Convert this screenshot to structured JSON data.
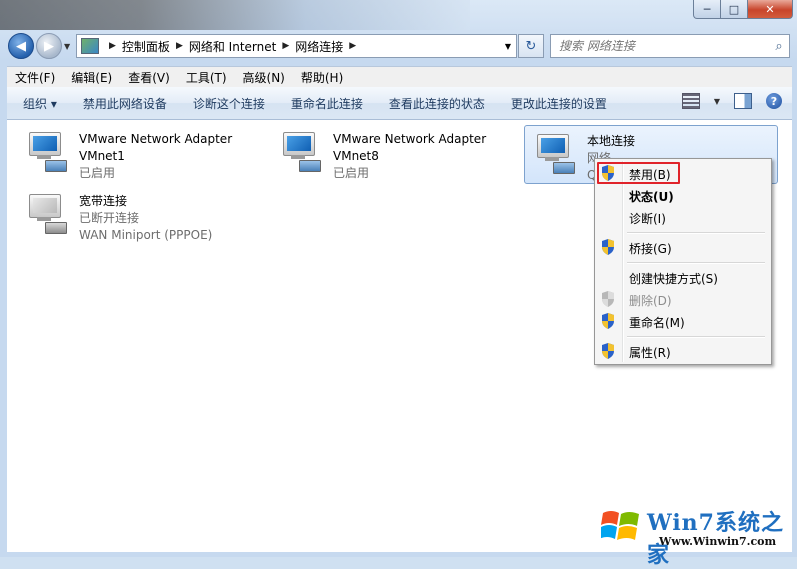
{
  "window": {
    "caption_min": "─",
    "caption_max": "□",
    "caption_close": "✕"
  },
  "nav": {
    "back_glyph": "◀",
    "forward_glyph": "▶",
    "recent_glyph": "▼",
    "breadcrumbs": [
      "控制面板",
      "网络和 Internet",
      "网络连接"
    ],
    "crumb_sep": "▶",
    "addr_drop_glyph": "▼",
    "refresh_glyph": "↻",
    "search_placeholder": "搜索 网络连接",
    "search_icon_glyph": "⌕"
  },
  "menubar": {
    "items": [
      "文件(F)",
      "编辑(E)",
      "查看(V)",
      "工具(T)",
      "高级(N)",
      "帮助(H)"
    ]
  },
  "cmdbar": {
    "organize": "组织 ▾",
    "items": [
      "禁用此网络设备",
      "诊断这个连接",
      "重命名此连接",
      "查看此连接的状态",
      "更改此连接的设置"
    ],
    "views_drop": "▼",
    "help_glyph": "?"
  },
  "connections": [
    {
      "name": "VMware Network Adapter",
      "sub1": "VMnet1",
      "sub2": "已启用"
    },
    {
      "name": "VMware Network Adapter",
      "sub1": "VMnet8",
      "sub2": "已启用"
    },
    {
      "name": "本地连接",
      "sub1": "网络",
      "sub2": "Q"
    },
    {
      "name": "宽带连接",
      "sub1": "已断开连接",
      "sub2": "WAN Miniport (PPPOE)"
    }
  ],
  "context_menu": {
    "items": [
      {
        "label": "禁用(B)"
      },
      {
        "label": "状态(U)"
      },
      {
        "label": "诊断(I)"
      },
      {
        "label": "桥接(G)"
      },
      {
        "label": "创建快捷方式(S)"
      },
      {
        "label": "删除(D)"
      },
      {
        "label": "重命名(M)"
      },
      {
        "label": "属性(R)"
      }
    ]
  },
  "watermark": {
    "title": "Win7系统之家",
    "url": "Www.Winwin7.com"
  },
  "colors": {
    "highlight_box": "#e0232a",
    "selection_border": "#7da2ce",
    "command_text": "#1e3a5f"
  }
}
